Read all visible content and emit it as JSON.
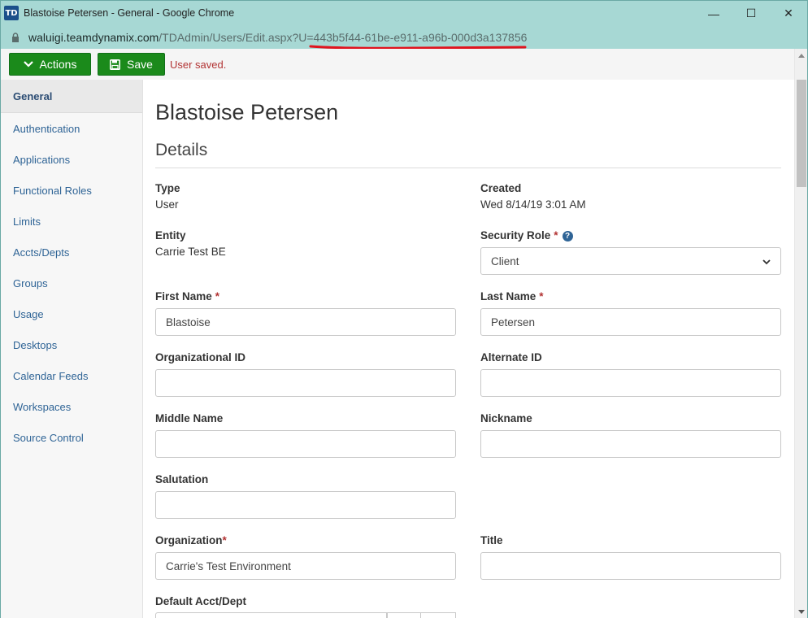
{
  "window": {
    "app_logo": "TD",
    "title": "Blastoise Petersen - General - Google Chrome",
    "minimize": "—",
    "maximize": "☐",
    "close": "✕"
  },
  "address": {
    "host": "waluigi.teamdynamix.com",
    "path": "/TDAdmin/Users/Edit.aspx?U=443b5f44-61be-e911-a96b-000d3a137856"
  },
  "toolbar": {
    "actions_label": "Actions",
    "save_label": "Save",
    "status": "User saved."
  },
  "sidebar": {
    "items": [
      {
        "label": "General",
        "active": true
      },
      {
        "label": "Authentication"
      },
      {
        "label": "Applications"
      },
      {
        "label": "Functional Roles"
      },
      {
        "label": "Limits"
      },
      {
        "label": "Accts/Depts"
      },
      {
        "label": "Groups"
      },
      {
        "label": "Usage"
      },
      {
        "label": "Desktops"
      },
      {
        "label": "Calendar Feeds"
      },
      {
        "label": "Workspaces"
      },
      {
        "label": "Source Control"
      }
    ]
  },
  "main": {
    "page_title": "Blastoise Petersen",
    "section_title": "Details",
    "type_label": "Type",
    "type_value": "User",
    "created_label": "Created",
    "created_value": "Wed 8/14/19 3:01 AM",
    "entity_label": "Entity",
    "entity_value": "Carrie Test BE",
    "security_role_label": "Security Role",
    "security_role_value": "Client",
    "first_name_label": "First Name",
    "first_name_value": "Blastoise",
    "last_name_label": "Last Name",
    "last_name_value": "Petersen",
    "org_id_label": "Organizational ID",
    "org_id_value": "",
    "alt_id_label": "Alternate ID",
    "alt_id_value": "",
    "middle_name_label": "Middle Name",
    "middle_name_value": "",
    "nickname_label": "Nickname",
    "nickname_value": "",
    "salutation_label": "Salutation",
    "salutation_value": "",
    "organization_label": "Organization",
    "organization_value": "Carrie's Test Environment",
    "title_label": "Title",
    "title_value": "",
    "default_acct_label": "Default Acct/Dept",
    "required_mark": "*",
    "help_mark": "?"
  },
  "colors": {
    "chrome": "#a7d8d4",
    "accent_green": "#1b8a1b",
    "link": "#2f6496",
    "error": "#b23333",
    "annotation_underline": "#e0141e"
  }
}
